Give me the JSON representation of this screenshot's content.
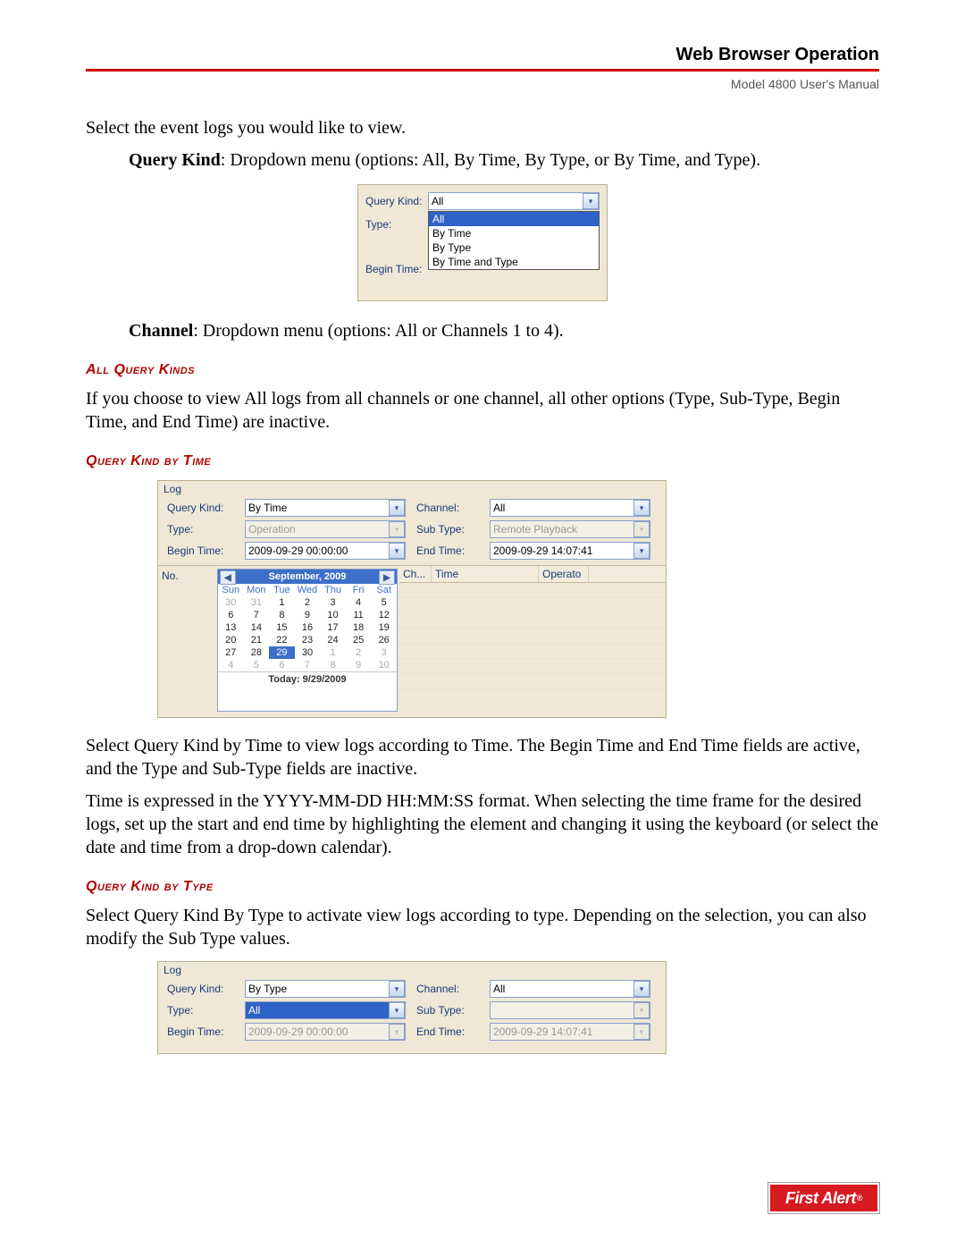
{
  "header": {
    "title": "Web Browser Operation",
    "subtitle": "Model 4800 User's Manual"
  },
  "para1": "Select the event logs you would like to view.",
  "query_kind_para": {
    "label": "Query Kind",
    "text": ": Dropdown menu (options: All, By Time, By Type, or By Time, and Type)."
  },
  "shot1": {
    "labels": {
      "query_kind": "Query Kind:",
      "type": "Type:",
      "begin_time": "Begin Time:"
    },
    "value": "All",
    "options": [
      "All",
      "By Time",
      "By Type",
      "By Time and Type"
    ]
  },
  "channel_para": {
    "label": "Channel",
    "text": ": Dropdown menu (options: All or Channels 1 to 4)."
  },
  "sec_all_title": "All Query Kinds",
  "sec_all_text": "If you choose to view All logs from all channels or one channel, all other options (Type, Sub-Type, Begin Time, and End Time) are inactive.",
  "sec_time_title": "Query Kind by Time",
  "shot2": {
    "legend": "Log",
    "labels": {
      "query_kind": "Query Kind:",
      "channel": "Channel:",
      "type": "Type:",
      "subtype": "Sub Type:",
      "begin": "Begin Time:",
      "end": "End Time:",
      "no": "No."
    },
    "values": {
      "query_kind": "By Time",
      "channel": "All",
      "type": "Operation",
      "subtype": "Remote Playback",
      "begin": "2009-09-29 00:00:00",
      "end": "2009-09-29 14:07:41"
    },
    "calendar": {
      "title": "September, 2009",
      "days": [
        "Sun",
        "Mon",
        "Tue",
        "Wed",
        "Thu",
        "Fri",
        "Sat"
      ],
      "grid": [
        [
          "30",
          "31",
          "1",
          "2",
          "3",
          "4",
          "5"
        ],
        [
          "6",
          "7",
          "8",
          "9",
          "10",
          "11",
          "12"
        ],
        [
          "13",
          "14",
          "15",
          "16",
          "17",
          "18",
          "19"
        ],
        [
          "20",
          "21",
          "22",
          "23",
          "24",
          "25",
          "26"
        ],
        [
          "27",
          "28",
          "29",
          "30",
          "1",
          "2",
          "3"
        ],
        [
          "4",
          "5",
          "6",
          "7",
          "8",
          "9",
          "10"
        ]
      ],
      "dim_first": 2,
      "dim_last_start": 31,
      "today": 29,
      "footer": "Today: 9/29/2009"
    },
    "log_headers": [
      "Ch...",
      "Time",
      "Operato"
    ]
  },
  "sec_time_p1": "Select Query Kind by Time to view logs according to Time. The Begin Time and End Time fields are active, and the Type and Sub-Type fields are inactive.",
  "sec_time_p2": "Time is expressed in the YYYY-MM-DD HH:MM:SS format. When selecting the time frame for the desired logs, set up the start and end time by highlighting the element and changing it using the keyboard (or select the date and time from a drop-down calendar).",
  "sec_type_title": "Query Kind by Type",
  "sec_type_text": "Select Query Kind By Type to activate view logs according to type. Depending on the selection, you can also modify the Sub Type values.",
  "shot3": {
    "legend": "Log",
    "labels": {
      "query_kind": "Query Kind:",
      "channel": "Channel:",
      "type": "Type:",
      "subtype": "Sub Type:",
      "begin": "Begin Time:",
      "end": "End Time:"
    },
    "values": {
      "query_kind": "By Type",
      "channel": "All",
      "type": "All",
      "subtype": "",
      "begin": "2009-09-29 00:00:00",
      "end": "2009-09-29 14:07:41"
    }
  },
  "brand": "First Alert"
}
